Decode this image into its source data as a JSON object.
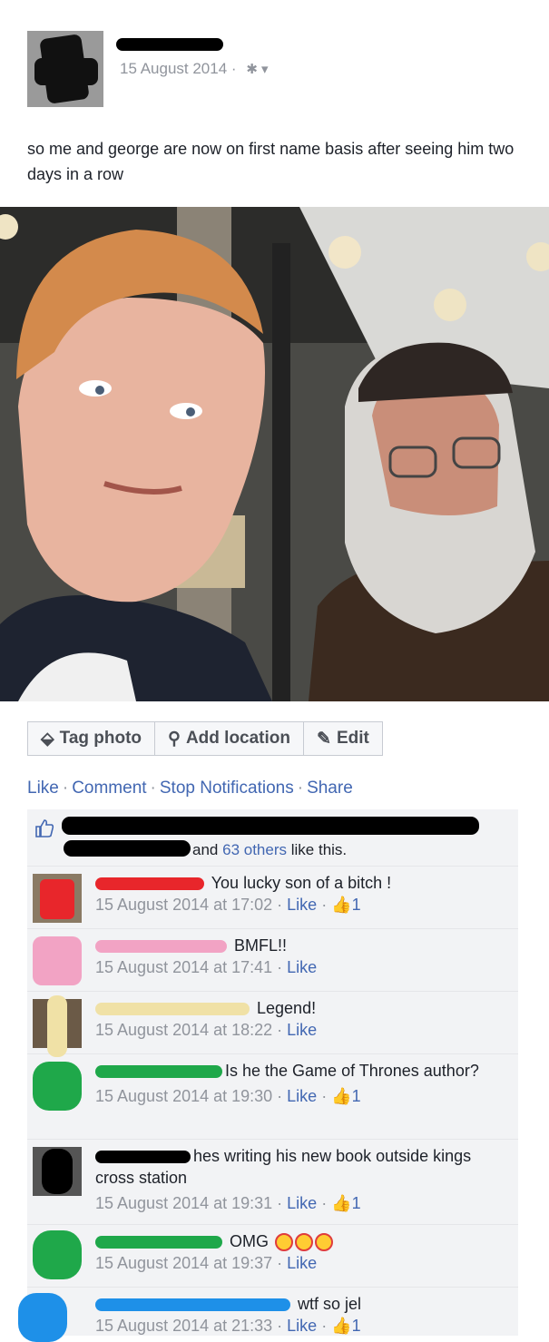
{
  "post": {
    "date": "15 August 2014",
    "separator": "·",
    "text": "so me and george are now on first name basis after seeing him two days in a row"
  },
  "photo_actions": {
    "tag_photo": "Tag photo",
    "add_location": "Add location",
    "edit": "Edit"
  },
  "post_links": {
    "like": "Like",
    "comment": "Comment",
    "stop_notifications": "Stop Notifications",
    "share": "Share"
  },
  "likes": {
    "and": "and",
    "others": "63 others",
    "suffix": "like this."
  },
  "comments": [
    {
      "text": "You lucky son of a bitch !",
      "time": "15 August 2014 at 17:02",
      "like": "Like",
      "count": "1",
      "mark_color": "#e8262b"
    },
    {
      "text": "BMFL!!",
      "time": "15 August 2014 at 17:41",
      "like": "Like",
      "count": "",
      "mark_color": "#f2a3c4"
    },
    {
      "text": "Legend!",
      "time": "15 August 2014 at 18:22",
      "like": "Like",
      "count": "",
      "mark_color": "#f0e1a6"
    },
    {
      "text": "Is he the Game of Thrones author?",
      "time": "15 August 2014 at 19:30",
      "like": "Like",
      "count": "1",
      "mark_color": "#1fa84a"
    },
    {
      "text": "hes writing his new book outside kings cross station",
      "time": "15 August 2014 at 19:31",
      "like": "Like",
      "count": "1",
      "mark_color": "#000000"
    },
    {
      "text": "OMG",
      "time": "15 August 2014 at 19:37",
      "like": "Like",
      "count": "",
      "mark_color": "#1fa84a"
    },
    {
      "text": "wtf so jel",
      "time": "15 August 2014 at 21:33",
      "like": "Like",
      "count": "1",
      "mark_color": "#1e90e8"
    }
  ],
  "colors": {
    "link": "#4267b2",
    "meta": "#90949c",
    "comment_bg": "#f2f3f5"
  }
}
